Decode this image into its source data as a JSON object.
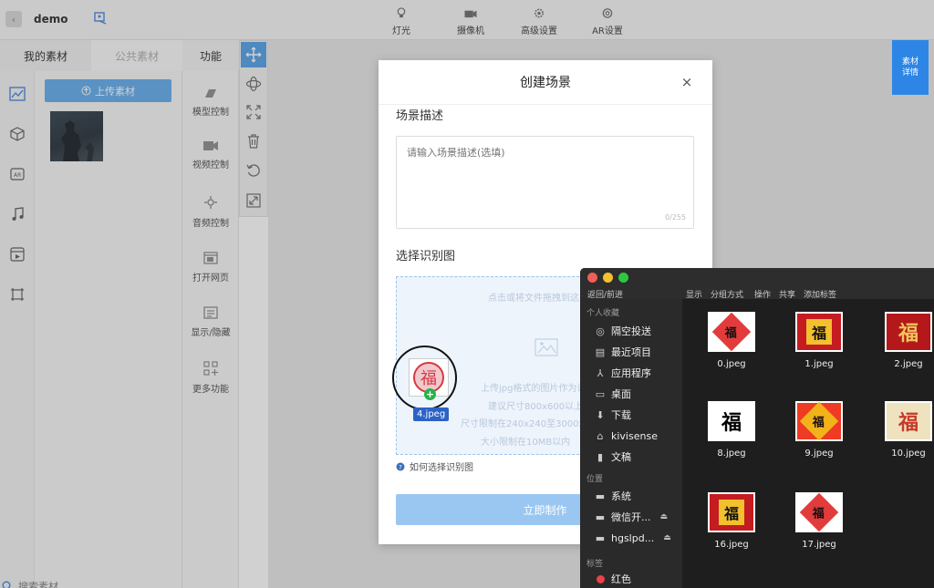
{
  "topbar": {
    "back": "‹",
    "app_name": "demo",
    "menus": [
      {
        "label": "灯光",
        "icon": "lightbulb-icon"
      },
      {
        "label": "摄像机",
        "icon": "camera-icon"
      },
      {
        "label": "高级设置",
        "icon": "gear-icon"
      },
      {
        "label": "AR设置",
        "icon": "ar-settings-icon"
      }
    ]
  },
  "left_panel": {
    "tabs": [
      "我的素材",
      "公共素材"
    ],
    "upload_button": "上传素材",
    "icons": [
      "image-icon",
      "cube-icon",
      "video-ar-icon",
      "music-icon",
      "film-icon",
      "frame-icon"
    ],
    "search_label": "搜索素材"
  },
  "function_panel": {
    "title": "功能",
    "items": [
      "模型控制",
      "视频控制",
      "音频控制",
      "打开网页",
      "显示/隐藏",
      "更多功能"
    ]
  },
  "toolstrip": [
    "move-icon",
    "rotate-icon",
    "scale-icon",
    "trash-icon",
    "undo-icon",
    "resize-icon"
  ],
  "material_detail": "素材\n详情",
  "modal": {
    "title": "创建场景",
    "close": "×",
    "desc_label": "场景描述",
    "desc_placeholder": "请输入场景描述(选填)",
    "desc_count": "0/255",
    "image_label": "选择识别图",
    "upload_hint_top": "点击或将文件拖拽到这里上传",
    "upload_lines": [
      "上传jpg格式的图片作为识别图",
      "建议尺寸800x600以上",
      "尺寸限制在240x240至3000x3000",
      "大小限制在10MB以内"
    ],
    "how_to": "如何选择识别图",
    "submit": "立即制作"
  },
  "drag": {
    "file_label": "4.jpeg",
    "glyph": "福"
  },
  "finder": {
    "back_forward": "返回/前进",
    "actions": [
      "显示",
      "分组方式",
      "操作",
      "共享",
      "添加标签"
    ],
    "favorites_header": "个人收藏",
    "favorites": [
      {
        "label": "隔空投送",
        "icon": "airdrop-icon"
      },
      {
        "label": "最近项目",
        "icon": "recents-icon"
      },
      {
        "label": "应用程序",
        "icon": "applications-icon"
      },
      {
        "label": "桌面",
        "icon": "desktop-icon"
      },
      {
        "label": "下载",
        "icon": "download-icon"
      },
      {
        "label": "kivisense",
        "icon": "home-icon"
      },
      {
        "label": "文稿",
        "icon": "documents-icon"
      }
    ],
    "locations_header": "位置",
    "locations": [
      {
        "label": "系统",
        "icon": "disk-icon"
      },
      {
        "label": "微信开...",
        "icon": "disk-icon",
        "eject": "⏏"
      },
      {
        "label": "hgslpd...",
        "icon": "disk-icon",
        "eject": "⏏"
      }
    ],
    "tags_header": "标签",
    "tags": [
      {
        "label": "红色",
        "color": "#e8434a"
      }
    ],
    "files": [
      {
        "name": "0.jpeg",
        "style": "diamond"
      },
      {
        "name": "1.jpeg",
        "style": "red"
      },
      {
        "name": "2.jpeg",
        "style": "red-gold"
      },
      {
        "name": "8.jpeg",
        "style": "ink"
      },
      {
        "name": "9.jpeg",
        "style": "diamond-gold"
      },
      {
        "name": "10.jpeg",
        "style": "beige"
      },
      {
        "name": "16.jpeg",
        "style": "red"
      },
      {
        "name": "17.jpeg",
        "style": "diamond"
      }
    ],
    "fu_glyph": "福"
  },
  "colors": {
    "accent": "#2d86e6",
    "submit": "#9ac7f1",
    "tag_red": "#e8434a"
  }
}
